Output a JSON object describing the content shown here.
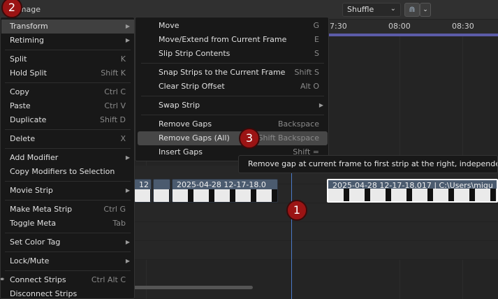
{
  "header": {
    "title": "r, Image",
    "playback_mode": "Shuffle",
    "snap_icon": "magnet-icon"
  },
  "timeline": {
    "ticks": [
      "7:30",
      "08:00",
      "08:30"
    ],
    "strips": [
      {
        "label": "12"
      },
      {
        "label": ""
      },
      {
        "label": "2025-04-28 12-17-18.0"
      },
      {
        "label": "2025-04-28 12-17-18.017 | C:\\Users\\migu"
      }
    ]
  },
  "main_menu": {
    "items": [
      {
        "label": "Transform",
        "shortcut": "",
        "submenu": true
      },
      {
        "label": "Retiming",
        "shortcut": "",
        "submenu": true
      },
      {
        "label": "Split",
        "shortcut": "K"
      },
      {
        "label": "Hold Split",
        "shortcut": "Shift K"
      },
      {
        "label": "Copy",
        "shortcut": "Ctrl C"
      },
      {
        "label": "Paste",
        "shortcut": "Ctrl V"
      },
      {
        "label": "Duplicate",
        "shortcut": "Shift D"
      },
      {
        "label": "Delete",
        "shortcut": "X"
      },
      {
        "label": "Add Modifier",
        "shortcut": "",
        "submenu": true
      },
      {
        "label": "Copy Modifiers to Selection",
        "shortcut": ""
      },
      {
        "label": "Movie Strip",
        "shortcut": "",
        "submenu": true
      },
      {
        "label": "Make Meta Strip",
        "shortcut": "Ctrl G"
      },
      {
        "label": "Toggle Meta",
        "shortcut": "Tab"
      },
      {
        "label": "Set Color Tag",
        "shortcut": "",
        "submenu": true
      },
      {
        "label": "Lock/Mute",
        "shortcut": "",
        "submenu": true
      },
      {
        "label": "Connect Strips",
        "shortcut": "Ctrl Alt C"
      },
      {
        "label": "Disconnect Strips",
        "shortcut": ""
      }
    ]
  },
  "transform_menu": {
    "items": [
      {
        "label": "Move",
        "shortcut": "G"
      },
      {
        "label": "Move/Extend from Current Frame",
        "shortcut": "E"
      },
      {
        "label": "Slip Strip Contents",
        "shortcut": "S"
      },
      {
        "label": "Snap Strips to the Current Frame",
        "shortcut": "Shift S"
      },
      {
        "label": "Clear Strip Offset",
        "shortcut": "Alt O"
      },
      {
        "label": "Swap Strip",
        "shortcut": "",
        "submenu": true
      },
      {
        "label": "Remove Gaps",
        "shortcut": "Backspace"
      },
      {
        "label": "Remove Gaps (All)",
        "shortcut": "Shift Backspace"
      },
      {
        "label": "Insert Gaps",
        "shortcut": "Shift ="
      }
    ]
  },
  "tooltip": {
    "text": "Remove gap at current frame to first strip at the right, independent o"
  },
  "callouts": [
    "1",
    "2",
    "3"
  ]
}
